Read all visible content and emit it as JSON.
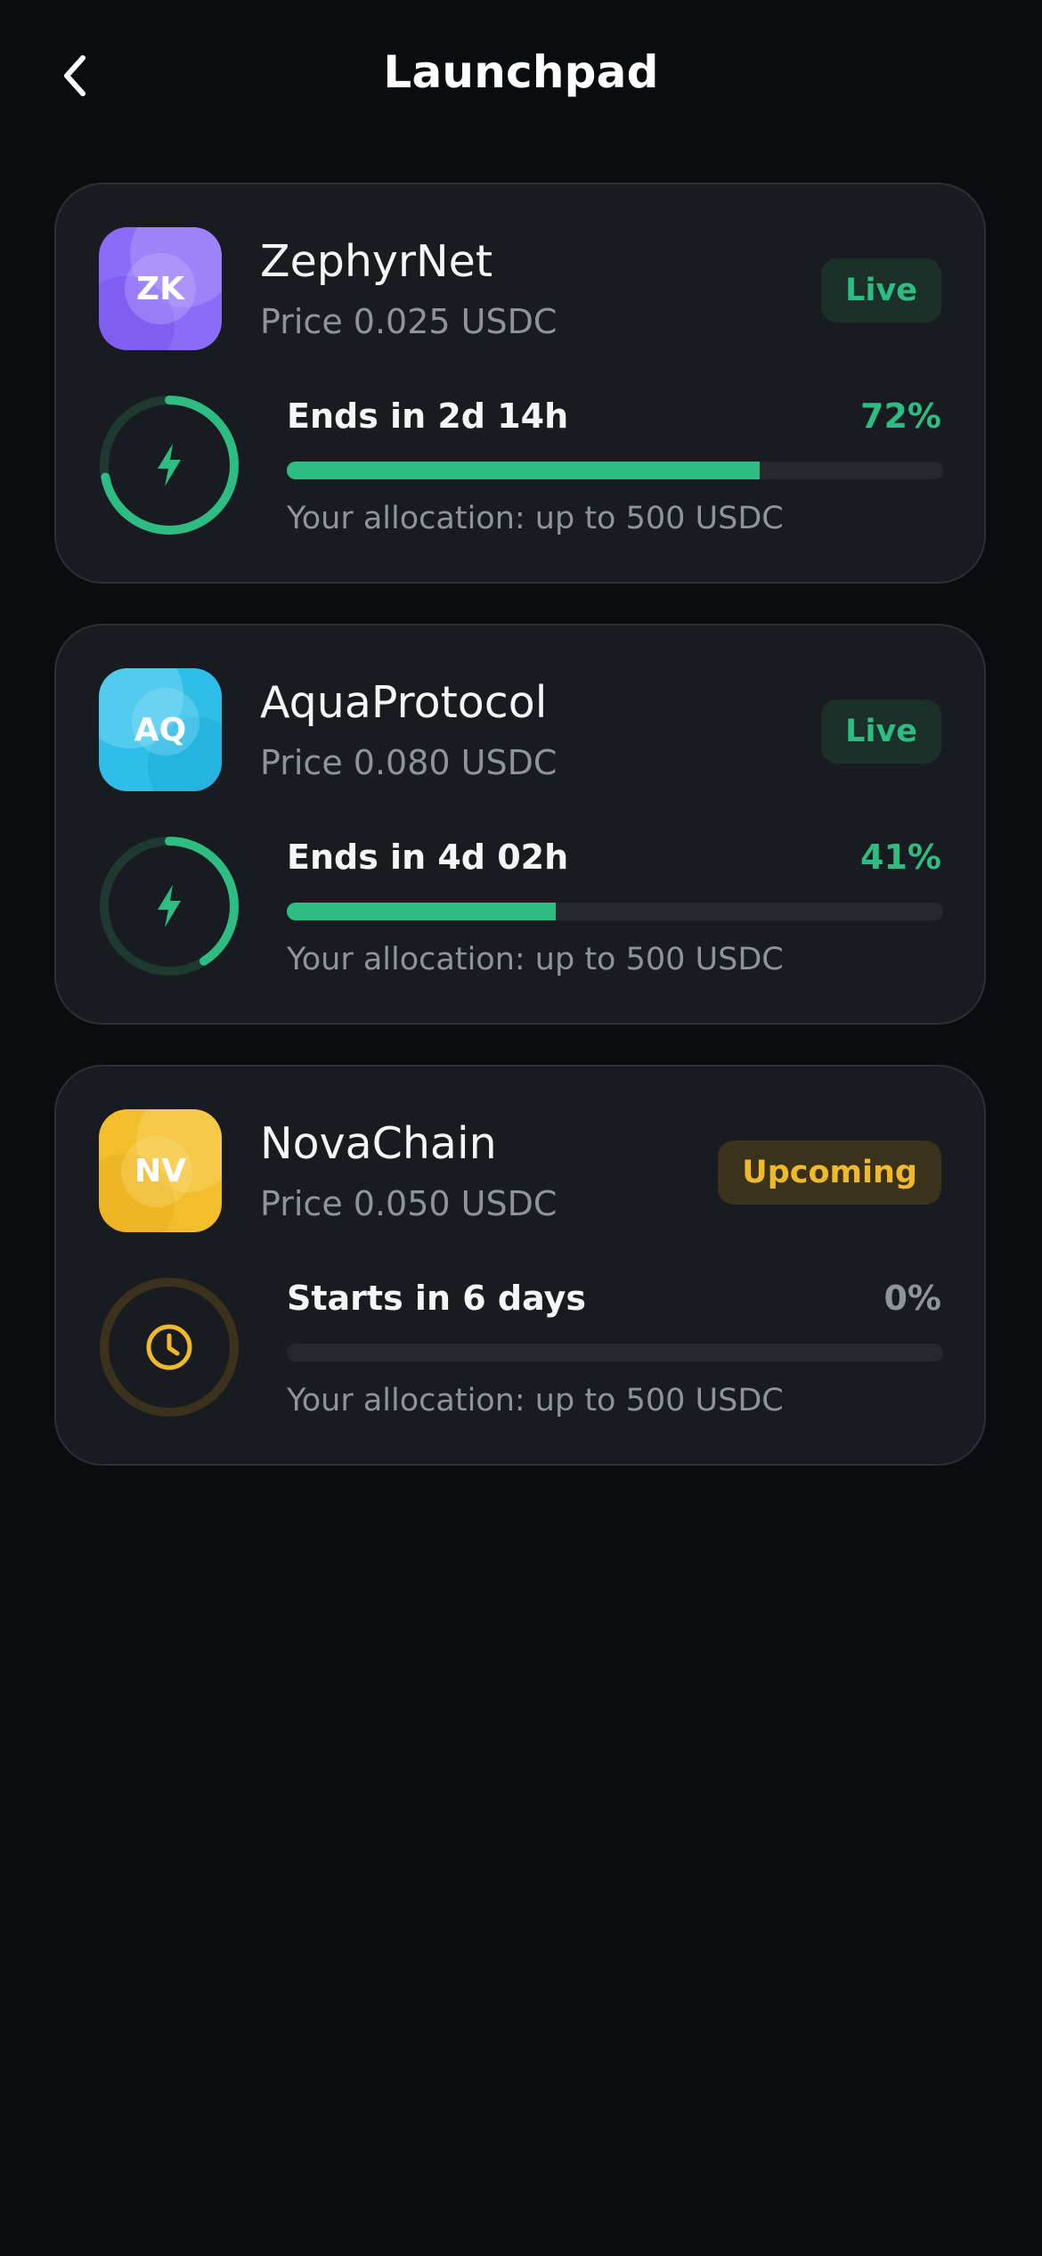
{
  "header": {
    "title": "Launchpad",
    "back_icon": "chevron-left-icon"
  },
  "colors": {
    "background": "#0a0d10",
    "card": "#181b1f",
    "accent_green": "#2dbd83",
    "accent_yellow": "#f0b92a",
    "muted_text": "#8e949c"
  },
  "projects": [
    {
      "logo_text": "ZK",
      "logo_color": "#8b6cf6",
      "name": "ZephyrNet",
      "price": "Price 0.025 USDC",
      "status": "Live",
      "timer": "Ends in 2d 14h",
      "percent_label": "72%",
      "progress": 0.72,
      "allocation": "Your allocation: up to 500 USDC",
      "icon": "lightning-bolt-icon"
    },
    {
      "logo_text": "AQ",
      "logo_color": "#2ebee8",
      "name": "AquaProtocol",
      "price": "Price 0.080 USDC",
      "status": "Live",
      "timer": "Ends in 4d 02h",
      "percent_label": "41%",
      "progress": 0.41,
      "allocation": "Your allocation: up to 500 USDC",
      "icon": "lightning-bolt-icon"
    },
    {
      "logo_text": "NV",
      "logo_color": "#f2be2c",
      "name": "NovaChain",
      "price": "Price 0.050 USDC",
      "status": "Upcoming",
      "timer": "Starts in 6 days",
      "percent_label": "0%",
      "progress": 0,
      "allocation": "Your allocation: up to 500 USDC",
      "icon": "clock-icon"
    }
  ]
}
